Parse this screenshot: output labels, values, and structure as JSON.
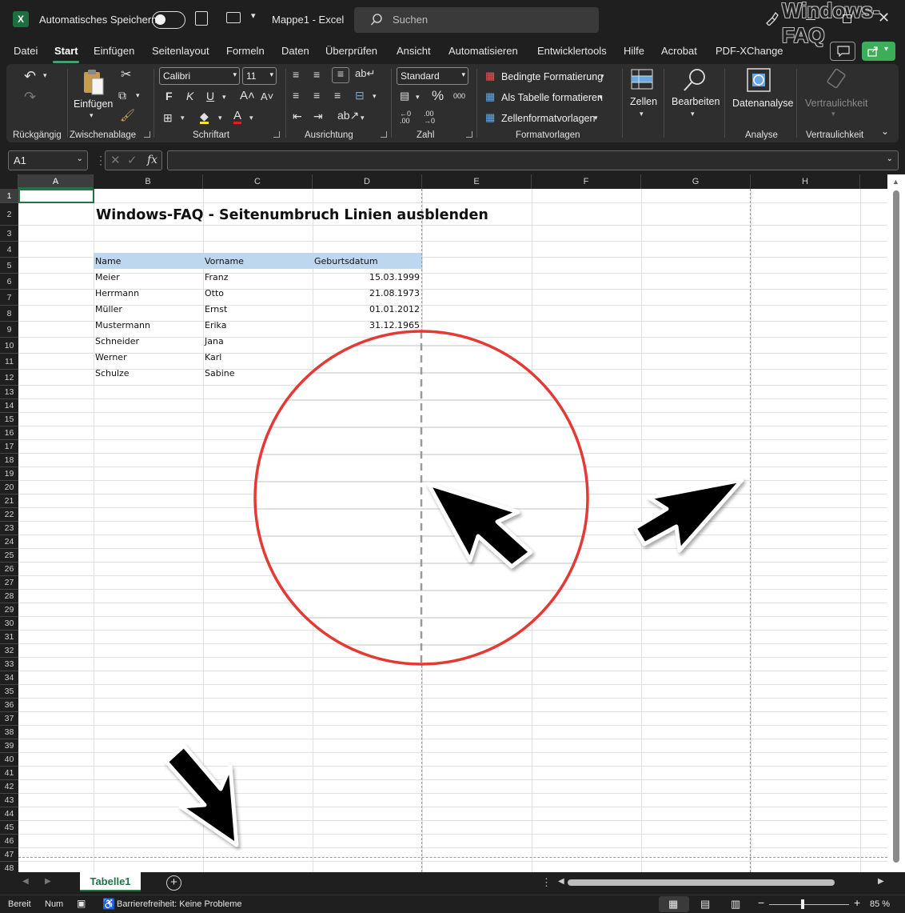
{
  "titlebar": {
    "autosave_label": "Automatisches Speichern",
    "document_title": "Mappe1  -  Excel",
    "search_placeholder": "Suchen",
    "watermark": "Windows-FAQ"
  },
  "menu": {
    "items": [
      "Datei",
      "Start",
      "Einfügen",
      "Seitenlayout",
      "Formeln",
      "Daten",
      "Überprüfen",
      "Ansicht",
      "Automatisieren",
      "Entwicklertools",
      "Hilfe",
      "Acrobat",
      "PDF-XChange"
    ],
    "active": "Start"
  },
  "ribbon": {
    "groups": {
      "undo": "Rückgängig",
      "clipboard": "Zwischenablage",
      "font": "Schriftart",
      "alignment": "Ausrichtung",
      "number": "Zahl",
      "styles": "Formatvorlagen",
      "analysis": "Analyse",
      "sensitivity": "Vertraulichkeit"
    },
    "paste_label": "Einfügen",
    "font_name": "Calibri",
    "font_size": "11",
    "bold": "F",
    "italic": "K",
    "underline": "U",
    "number_format": "Standard",
    "conditional_formatting": "Bedingte Formatierung",
    "format_as_table": "Als Tabelle formatieren",
    "cell_styles": "Zellenformatvorlagen",
    "cells_label": "Zellen",
    "editing_label": "Bearbeiten",
    "data_analysis_label": "Datenanalyse",
    "sensitivity_label": "Vertraulichkeit"
  },
  "formulabar": {
    "namebox": "A1",
    "fx": "fx",
    "formula": ""
  },
  "sheet": {
    "columns": [
      "A",
      "B",
      "C",
      "D",
      "E",
      "F",
      "G",
      "H"
    ],
    "selected_column": "A",
    "selected_row": "1",
    "rows": [
      "1",
      "2",
      "3",
      "4",
      "5",
      "6",
      "7",
      "8",
      "9",
      "10",
      "11",
      "12",
      "13",
      "14",
      "15",
      "16",
      "17",
      "18",
      "19",
      "20",
      "21",
      "22",
      "23",
      "24",
      "25",
      "26",
      "27",
      "28",
      "29",
      "30",
      "31",
      "32",
      "33",
      "34",
      "35",
      "36",
      "37",
      "38",
      "39",
      "40",
      "41",
      "42",
      "43",
      "44",
      "45",
      "46",
      "47",
      "48"
    ],
    "title": "Windows-FAQ - Seitenumbruch Linien ausblenden",
    "table_headers": [
      "Name",
      "Vorname",
      "Geburtsdatum"
    ],
    "table_rows": [
      [
        "Meier",
        "Franz",
        "15.03.1999"
      ],
      [
        "Herrmann",
        "Otto",
        "21.08.1973"
      ],
      [
        "Müller",
        "Ernst",
        "01.01.2012"
      ],
      [
        "Mustermann",
        "Erika",
        "31.12.1965"
      ],
      [
        "Schneider",
        "Jana",
        ""
      ],
      [
        "Werner",
        "Karl",
        ""
      ],
      [
        "Schulze",
        "Sabine",
        ""
      ]
    ],
    "header_fill_color": "#bdd7ee",
    "selection_color": "#217346"
  },
  "sheet_tabs": {
    "tabs": [
      "Tabelle1"
    ],
    "active": "Tabelle1"
  },
  "statusbar": {
    "ready": "Bereit",
    "num": "Num",
    "accessibility": "Barrierefreiheit: Keine Probleme",
    "zoom": "85 %"
  },
  "annotation": {
    "circle_color": "#e53935",
    "arrow_color": "#000000"
  }
}
